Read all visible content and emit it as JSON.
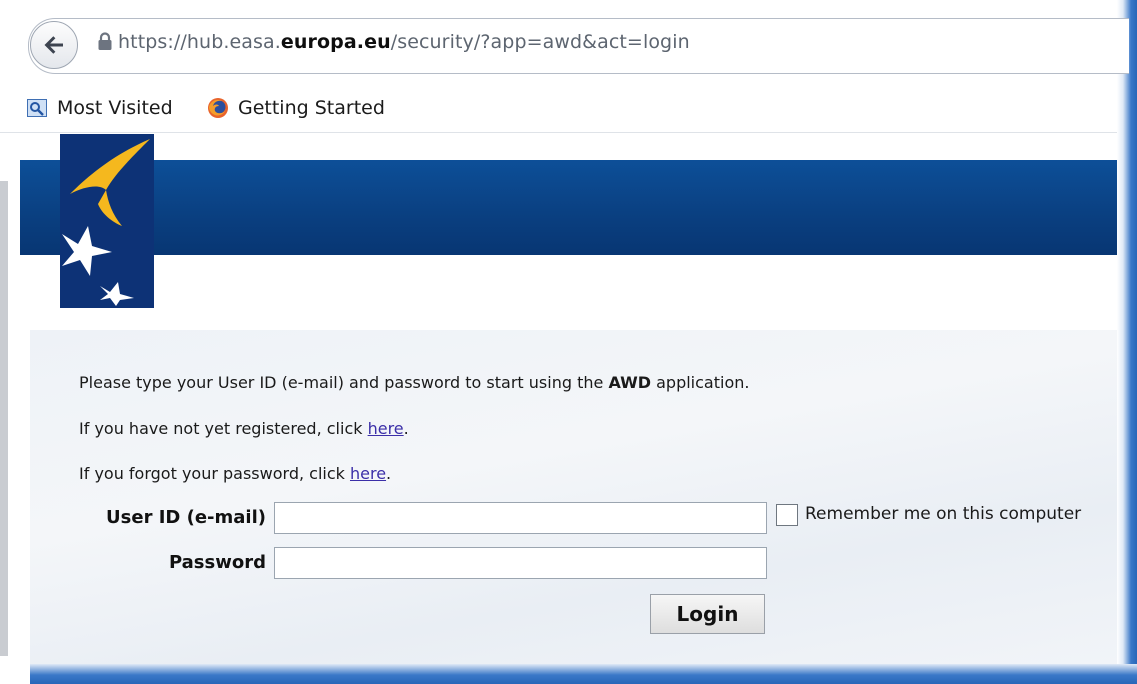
{
  "browser": {
    "url": {
      "prefix": "https://hub.easa.",
      "domain": "europa.eu",
      "path": "/security/?app=awd&act=login"
    },
    "bookmarks": [
      {
        "label": "Most Visited",
        "icon": "bookmarks-folder-icon"
      },
      {
        "label": "Getting Started",
        "icon": "firefox-icon"
      }
    ]
  },
  "login": {
    "intro_prefix": "Please type your User ID (e-mail) and password to start using the ",
    "intro_app": "AWD",
    "intro_suffix": " application.",
    "register_prefix": "If you have not yet registered, click ",
    "register_link": "here",
    "register_suffix": ".",
    "forgot_prefix": "If you forgot your password, click ",
    "forgot_link": "here",
    "forgot_suffix": ".",
    "user_label": "User ID (e-mail)",
    "user_value": "",
    "password_label": "Password",
    "password_value": "",
    "remember_label": "Remember me on this computer",
    "remember_checked": false,
    "login_button": "Login"
  },
  "colors": {
    "banner": "#0a3f80",
    "logo_background": "#0d3276",
    "logo_bird": "#f5b81e",
    "link": "#3b2fa8"
  }
}
